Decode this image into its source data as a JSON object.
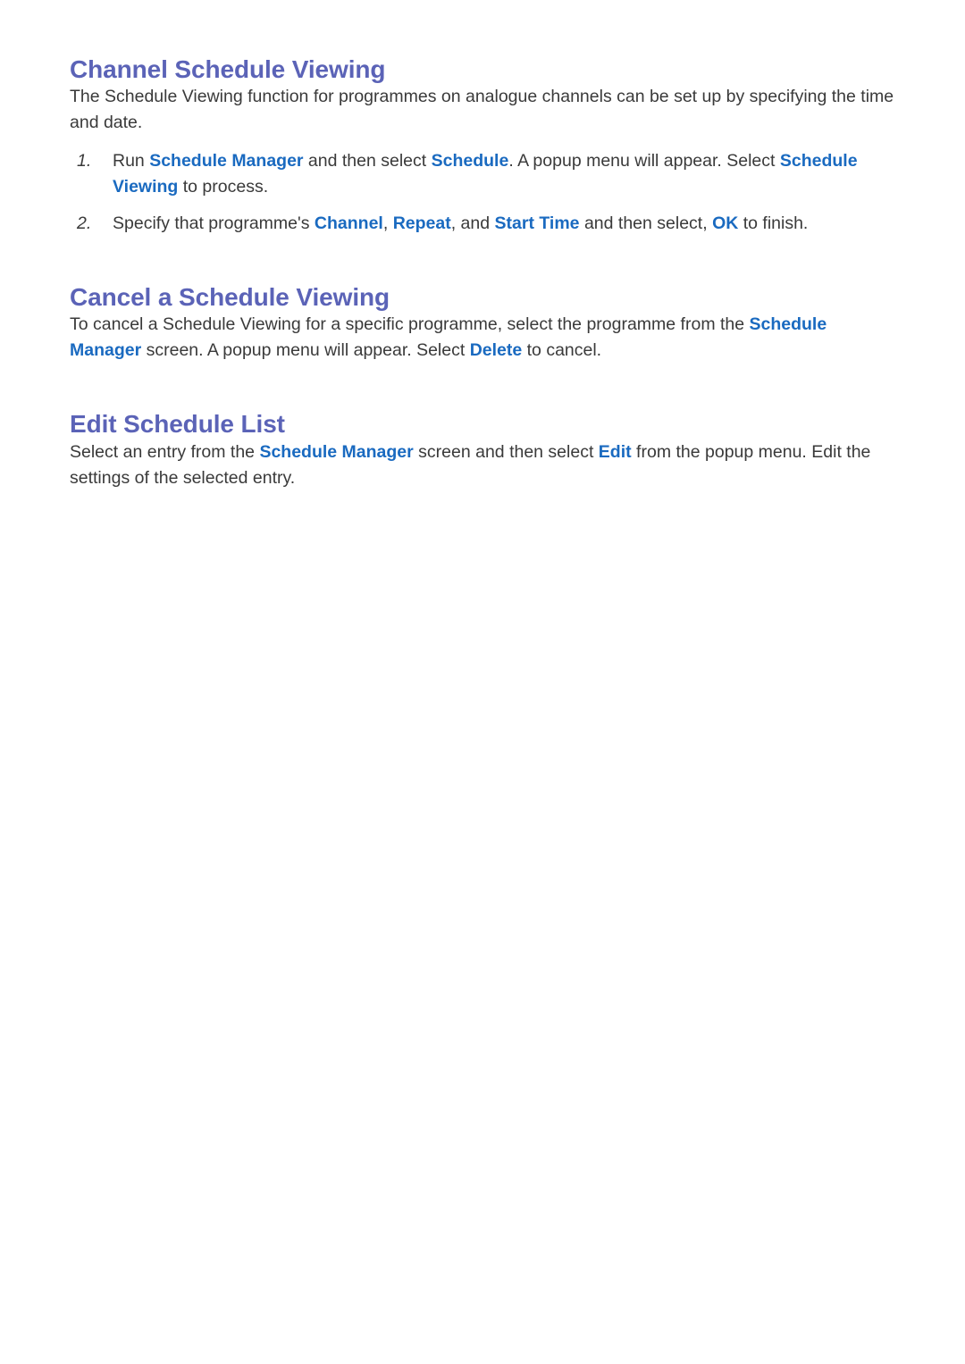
{
  "document": {
    "sections": [
      {
        "id": "channel-schedule-viewing",
        "heading": "Channel Schedule Viewing",
        "intro": "The Schedule Viewing function for programmes on analogue channels can be set up by specifying the time and date.",
        "steps": [
          {
            "number": "1.",
            "parts": [
              {
                "text": "Run ",
                "kw": false
              },
              {
                "text": "Schedule Manager",
                "kw": true
              },
              {
                "text": " and then select ",
                "kw": false
              },
              {
                "text": "Schedule",
                "kw": true
              },
              {
                "text": ". A popup menu will appear. Select ",
                "kw": false
              },
              {
                "text": "Schedule Viewing",
                "kw": true
              },
              {
                "text": " to process.",
                "kw": false
              }
            ]
          },
          {
            "number": "2.",
            "parts": [
              {
                "text": "Specify that programme's ",
                "kw": false
              },
              {
                "text": "Channel",
                "kw": true
              },
              {
                "text": ", ",
                "kw": false
              },
              {
                "text": "Repeat",
                "kw": true
              },
              {
                "text": ", and ",
                "kw": false
              },
              {
                "text": "Start Time",
                "kw": true
              },
              {
                "text": " and then select, ",
                "kw": false
              },
              {
                "text": "OK",
                "kw": true
              },
              {
                "text": " to finish.",
                "kw": false
              }
            ]
          }
        ]
      },
      {
        "id": "cancel-a-schedule-viewing",
        "heading": "Cancel a Schedule Viewing",
        "paragraph_parts": [
          {
            "text": "To cancel a Schedule Viewing for a specific programme, select the programme from the ",
            "kw": false
          },
          {
            "text": "Schedule Manager",
            "kw": true
          },
          {
            "text": " screen. A popup menu will appear. Select ",
            "kw": false
          },
          {
            "text": "Delete",
            "kw": true
          },
          {
            "text": " to cancel.",
            "kw": false
          }
        ]
      },
      {
        "id": "edit-schedule-list",
        "heading": "Edit Schedule List",
        "paragraph_parts": [
          {
            "text": "Select an entry from the ",
            "kw": false
          },
          {
            "text": "Schedule Manager",
            "kw": true
          },
          {
            "text": " screen and then select ",
            "kw": false
          },
          {
            "text": "Edit",
            "kw": true
          },
          {
            "text": " from the popup menu. Edit the settings of the selected entry.",
            "kw": false
          }
        ]
      }
    ]
  },
  "colors": {
    "heading": "#5b63b7",
    "keyword": "#1a6ac0",
    "body": "#3a3a3a",
    "background": "#ffffff"
  }
}
